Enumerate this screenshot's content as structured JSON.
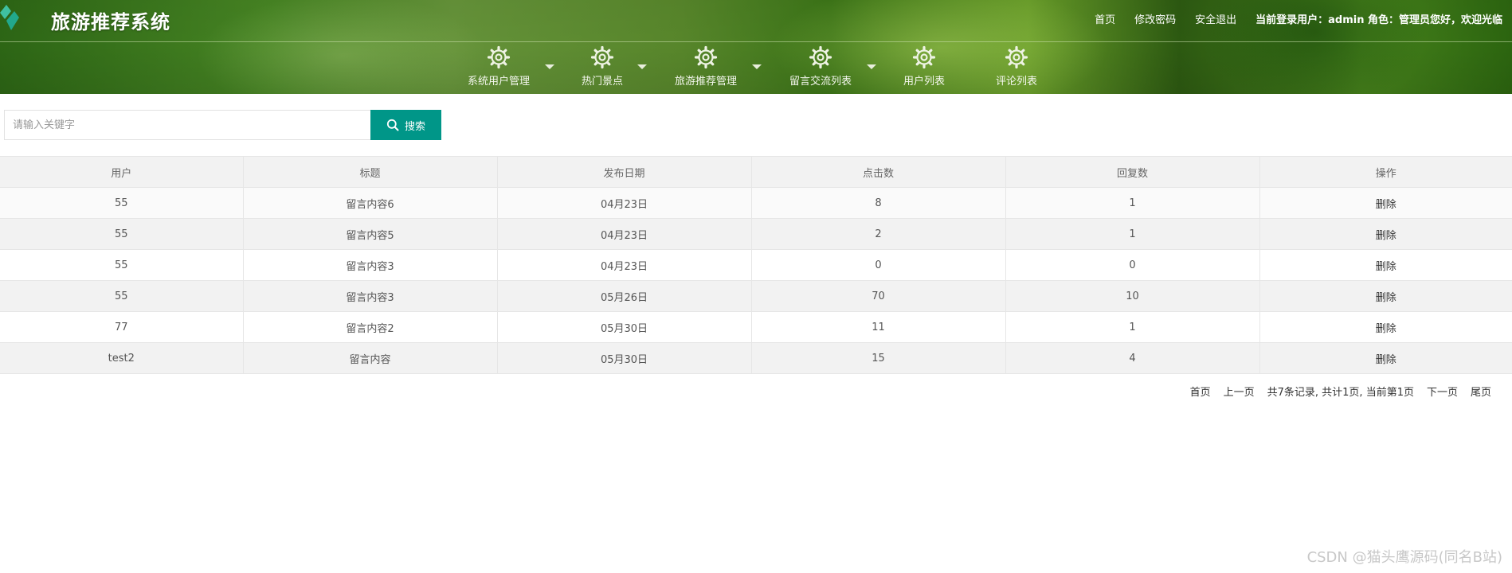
{
  "header": {
    "app_title": "旅游推荐系统",
    "links": {
      "home": "首页",
      "change_password": "修改密码",
      "logout": "安全退出"
    },
    "user_info": "当前登录用户：admin 角色：管理员您好，欢迎光临"
  },
  "nav": {
    "items": [
      {
        "label": "系统用户管理",
        "icon": "gear-icon",
        "has_dropdown": true
      },
      {
        "label": "热门景点",
        "icon": "gear-icon",
        "has_dropdown": true
      },
      {
        "label": "旅游推荐管理",
        "icon": "gear-icon",
        "has_dropdown": true
      },
      {
        "label": "留言交流列表",
        "icon": "gear-icon",
        "has_dropdown": true
      },
      {
        "label": "用户列表",
        "icon": "gear-icon",
        "has_dropdown": false
      },
      {
        "label": "评论列表",
        "icon": "gear-icon",
        "has_dropdown": false
      }
    ]
  },
  "search": {
    "placeholder": "请输入关键字",
    "value": "",
    "button_label": "搜索"
  },
  "table": {
    "headers": [
      "用户",
      "标题",
      "发布日期",
      "点击数",
      "回复数",
      "操作"
    ],
    "rows": [
      {
        "user": "55",
        "title": "留言内容6",
        "date": "04月23日",
        "clicks": "8",
        "replies": "1",
        "action": "删除"
      },
      {
        "user": "55",
        "title": "留言内容5",
        "date": "04月23日",
        "clicks": "2",
        "replies": "1",
        "action": "删除"
      },
      {
        "user": "55",
        "title": "留言内容3",
        "date": "04月23日",
        "clicks": "0",
        "replies": "0",
        "action": "删除"
      },
      {
        "user": "55",
        "title": "留言内容3",
        "date": "05月26日",
        "clicks": "70",
        "replies": "10",
        "action": "删除"
      },
      {
        "user": "77",
        "title": "留言内容2",
        "date": "05月30日",
        "clicks": "11",
        "replies": "1",
        "action": "删除"
      },
      {
        "user": "test2",
        "title": "留言内容",
        "date": "05月30日",
        "clicks": "15",
        "replies": "4",
        "action": "删除"
      }
    ]
  },
  "pager": {
    "first": "首页",
    "prev": "上一页",
    "summary": "共7条记录, 共计1页, 当前第1页",
    "next": "下一页",
    "last": "尾页"
  },
  "watermark": "CSDN @猫头鹰源码(同名B站)",
  "colors": {
    "accent": "#009688",
    "header_green": "#4a8b25"
  }
}
